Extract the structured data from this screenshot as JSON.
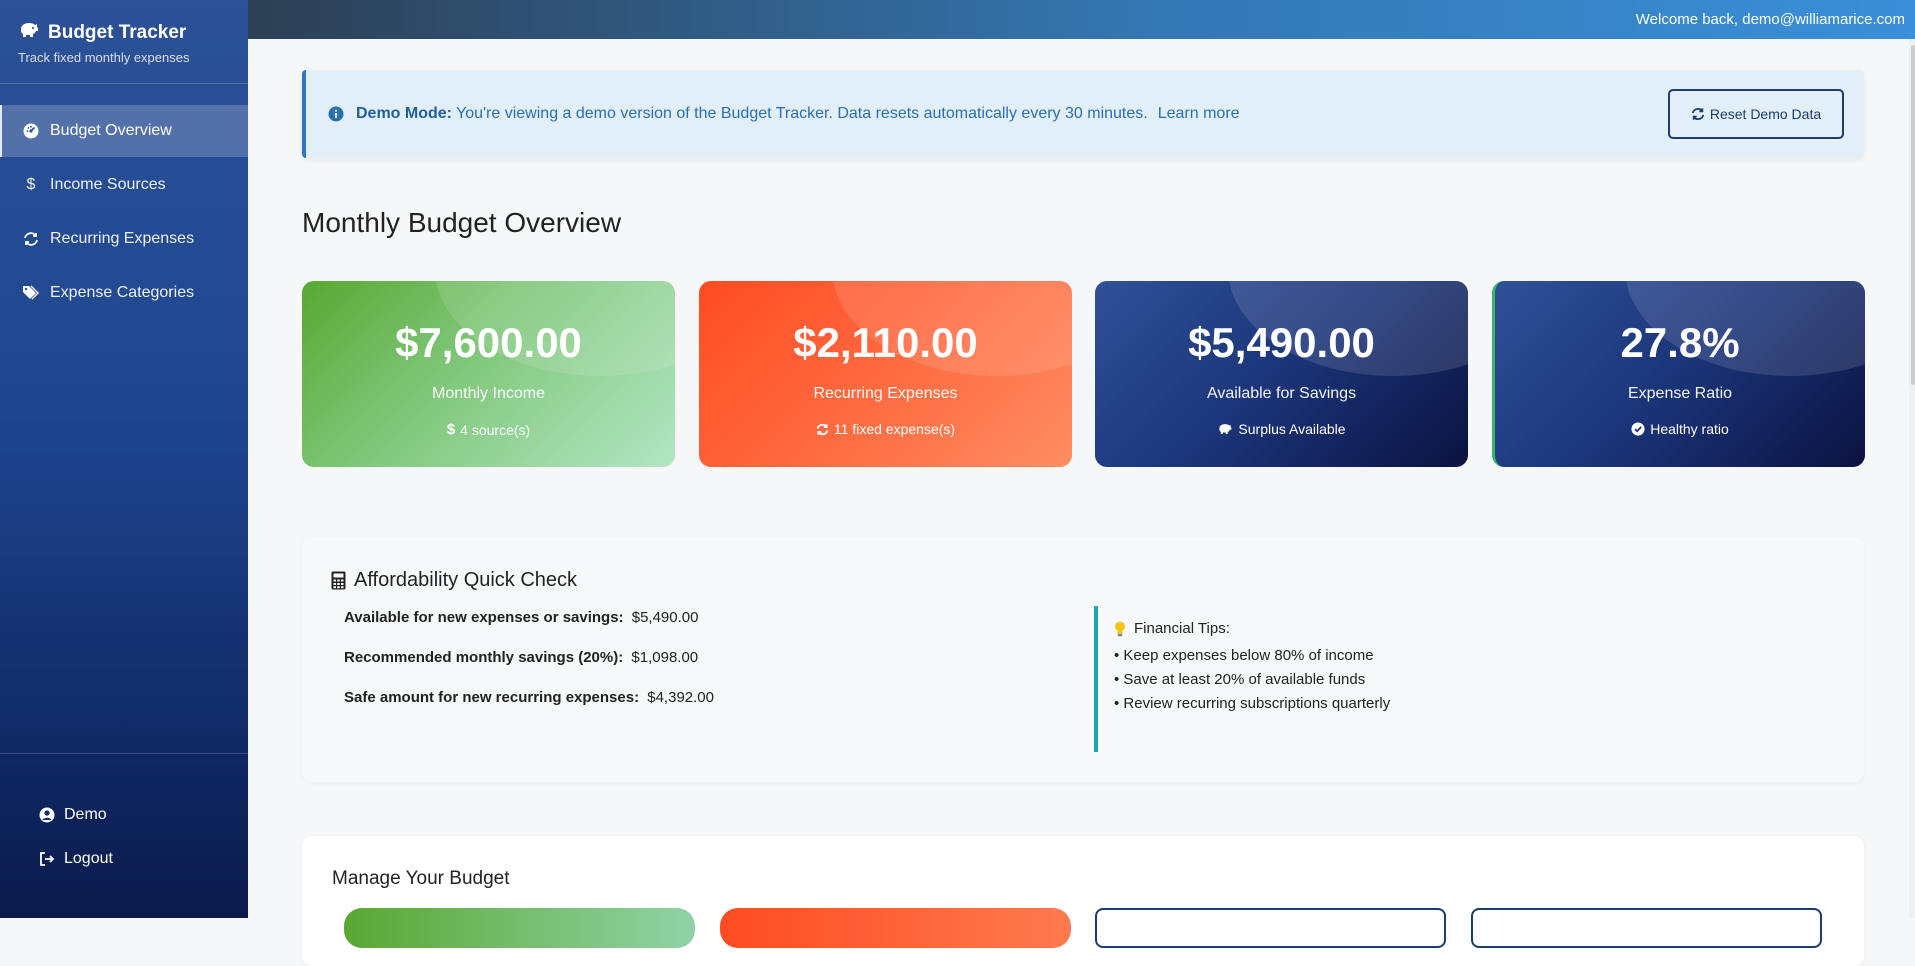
{
  "sidebar": {
    "brand_title": "Budget Tracker",
    "brand_subtitle": "Track fixed monthly expenses",
    "items": [
      {
        "label": "Budget Overview",
        "icon": "dashboard-icon",
        "active": true
      },
      {
        "label": "Income Sources",
        "icon": "dollar-icon",
        "active": false
      },
      {
        "label": "Recurring Expenses",
        "icon": "repeat-icon",
        "active": false
      },
      {
        "label": "Expense Categories",
        "icon": "tags-icon",
        "active": false
      }
    ],
    "user_label": "Demo",
    "logout_label": "Logout"
  },
  "topbar": {
    "welcome": "Welcome back, demo@williamarice.com"
  },
  "alert": {
    "title": "Demo Mode:",
    "message": "You're viewing a demo version of the Budget Tracker. Data resets automatically every 30 minutes.",
    "link": "Learn more",
    "reset_label": "Reset Demo Data"
  },
  "page_title": "Monthly Budget Overview",
  "cards": [
    {
      "value": "$7,600.00",
      "label": "Monthly Income",
      "sub": "4 source(s)",
      "icon": "dollar-icon"
    },
    {
      "value": "$2,110.00",
      "label": "Recurring Expenses",
      "sub": "11 fixed expense(s)",
      "icon": "repeat-icon"
    },
    {
      "value": "$5,490.00",
      "label": "Available for Savings",
      "sub": "Surplus Available",
      "icon": "piggy-bank-icon"
    },
    {
      "value": "27.8%",
      "label": "Expense Ratio",
      "sub": "Healthy ratio",
      "icon": "check-circle-icon"
    }
  ],
  "affordability": {
    "title": "Affordability Quick Check",
    "rows": [
      {
        "label": "Available for new expenses or savings:",
        "value": "$5,490.00"
      },
      {
        "label": "Recommended monthly savings (20%):",
        "value": "$1,098.00"
      },
      {
        "label": "Safe amount for new recurring expenses:",
        "value": "$4,392.00"
      }
    ],
    "tips_title": "Financial Tips:",
    "tips": [
      "• Keep expenses below 80% of income",
      "• Save at least 20% of available funds",
      "• Review recurring subscriptions quarterly"
    ]
  },
  "manage": {
    "title": "Manage Your Budget"
  },
  "colors": {
    "sidebar": "#1f4690",
    "income": "#58a832",
    "expense": "#ff4b22",
    "navy": "#1b3478",
    "info": "#2c77c0",
    "teal": "#1fa3b8"
  }
}
